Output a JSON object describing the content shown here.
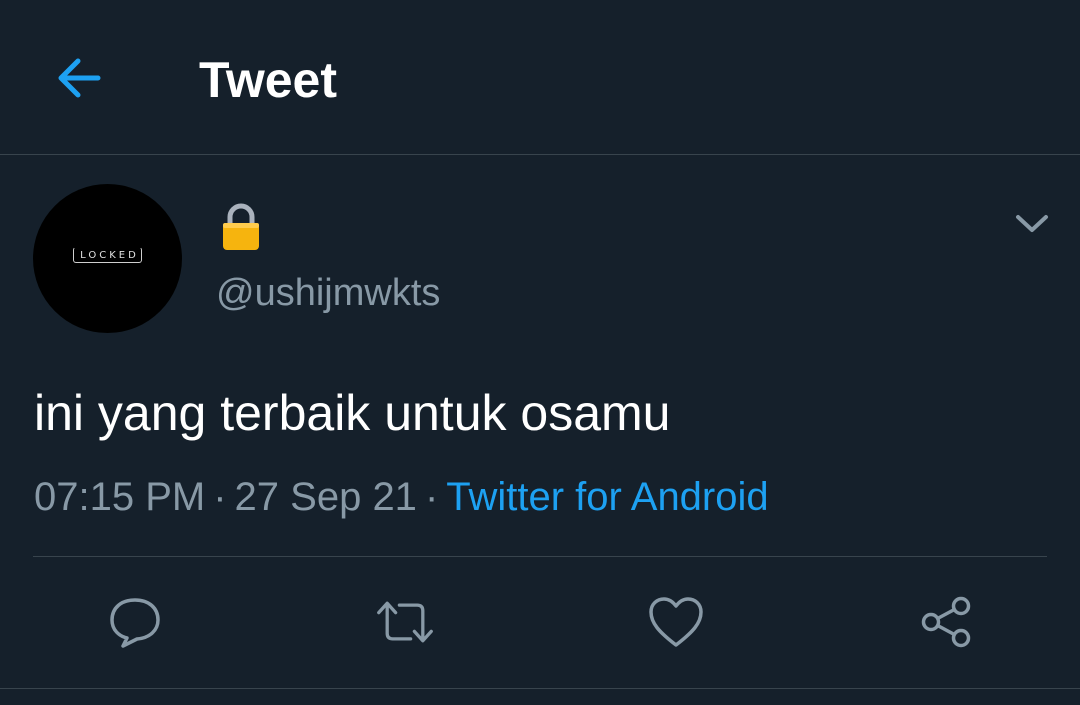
{
  "header": {
    "title": "Tweet",
    "back_icon": "arrow-left-icon"
  },
  "colors": {
    "background": "#15202b",
    "accent": "#1da1f2",
    "secondary_text": "#8899a6",
    "divider": "#38444d"
  },
  "tweet": {
    "avatar_label": "LOCKED",
    "display_name_icon": "padlock-emoji",
    "handle": "@ushijmwkts",
    "text": "ini yang terbaik untuk osamu",
    "time": "07:15 PM",
    "separator": "·",
    "date": "27 Sep 21",
    "source": "Twitter for Android"
  },
  "actions": [
    {
      "icon": "reply-icon"
    },
    {
      "icon": "retweet-icon"
    },
    {
      "icon": "like-icon"
    },
    {
      "icon": "share-icon"
    }
  ]
}
